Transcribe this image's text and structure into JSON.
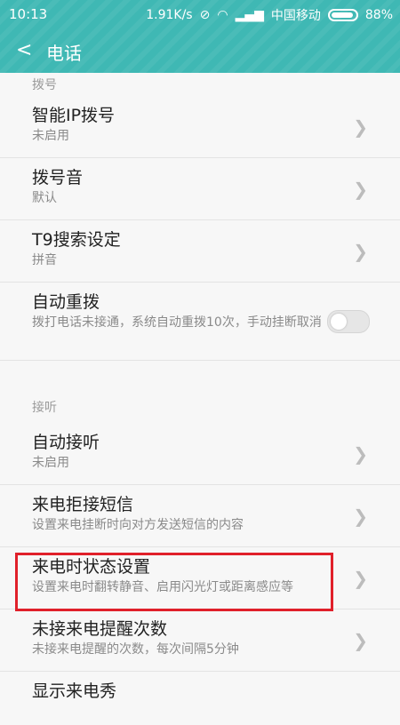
{
  "statusbar": {
    "time": "10:13",
    "speed": "1.91K/s",
    "carrier": "中国移动",
    "battery": "88%"
  },
  "header": {
    "back_icon": "<",
    "title": "电话"
  },
  "sections": {
    "dial": {
      "label": "拨号",
      "items": [
        {
          "title": "智能IP拨号",
          "sub": "未启用"
        },
        {
          "title": "拨号音",
          "sub": "默认"
        },
        {
          "title": "T9搜索设定",
          "sub": "拼音"
        },
        {
          "title": "自动重拨",
          "sub": "拨打电话未接通，系统自动重拨10次，手动挂断取消",
          "toggle": "off"
        }
      ]
    },
    "answer": {
      "label": "接听",
      "items": [
        {
          "title": "自动接听",
          "sub": "未启用"
        },
        {
          "title": "来电拒接短信",
          "sub": "设置来电挂断时向对方发送短信的内容"
        },
        {
          "title": "来电时状态设置",
          "sub": "设置来电时翻转静音、启用闪光灯或距离感应等"
        },
        {
          "title": "未接来电提醒次数",
          "sub": "未接来电提醒的次数，每次间隔5分钟"
        },
        {
          "title": "显示来电秀"
        }
      ]
    }
  }
}
